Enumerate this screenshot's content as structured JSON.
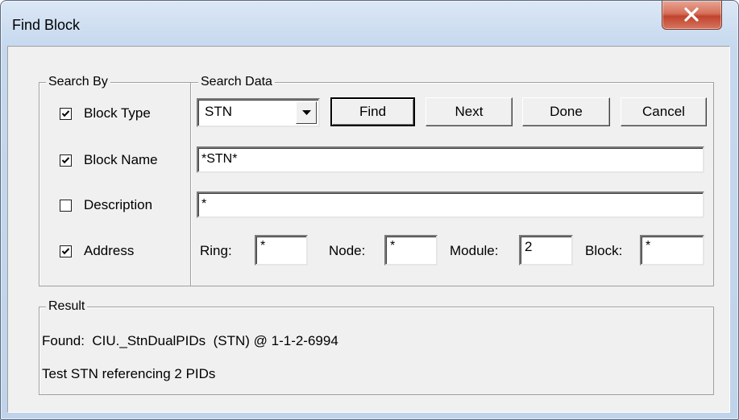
{
  "window": {
    "title": "Find Block",
    "close_label": "X"
  },
  "search_by": {
    "legend": "Search By",
    "items": [
      {
        "label": "Block Type",
        "checked": true
      },
      {
        "label": "Block Name",
        "checked": true
      },
      {
        "label": "Description",
        "checked": false
      },
      {
        "label": "Address",
        "checked": true
      }
    ]
  },
  "search_data": {
    "legend": "Search Data",
    "block_type_value": "STN",
    "buttons": {
      "find": "Find",
      "next": "Next",
      "done": "Done",
      "cancel": "Cancel"
    },
    "block_name_value": "*STN*",
    "description_value": "*",
    "address": {
      "ring_label": "Ring:",
      "ring_value": "*",
      "node_label": "Node:",
      "node_value": "*",
      "module_label": "Module:",
      "module_value": "2",
      "block_label": "Block:",
      "block_value": "*"
    }
  },
  "result": {
    "legend": "Result",
    "found_text": "Found:  CIU._StnDualPIDs  (STN) @ 1-1-2-6994",
    "description_text": "Test STN referencing 2 PIDs"
  }
}
